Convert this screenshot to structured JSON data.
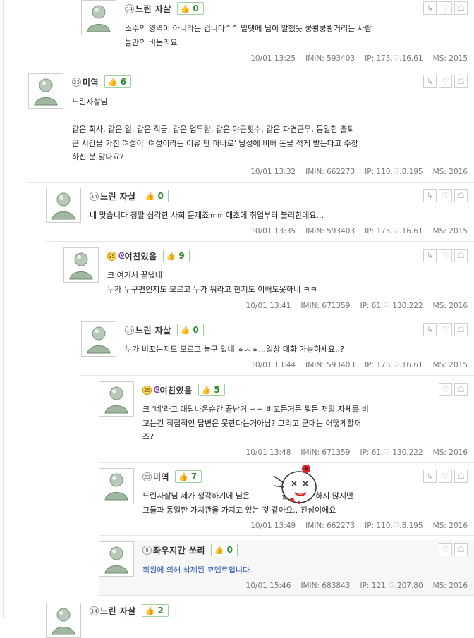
{
  "comments": [
    {
      "level": "14",
      "level_style": "gray",
      "nickname": "느린 자살",
      "likes": "0",
      "body": "소수의 영역이 아니라는 겁니다^^ 밑댓에 님이 말했듯 쿵쾅쿵쾅거리는 사람\n들만의 비논리요",
      "date": "10/01 13:25",
      "imin": "IMIN: 593403",
      "ip": "IP: 175.♡.16.61",
      "ms": "MS: 2015"
    },
    {
      "level": "23",
      "level_style": "gray",
      "nickname": "미역",
      "likes": "6",
      "body": "느린자살님\n\n같은 회사, 같은 일, 같은 직급, 같은 업무량, 같은 야근횟수, 같은 파견근무, 동일한 출퇴\n근 시간을 가진 여성이 '여성이라는 이유 단 하나로' 남성에 비해 돈을 적게 받는다고 주장\n하신 분 맞나요?",
      "date": "10/01 13:32",
      "imin": "IMIN: 662273",
      "ip": "IP: 110.♡.8.195",
      "ms": "MS: 2016"
    },
    {
      "level": "14",
      "level_style": "gray",
      "nickname": "느린 자살",
      "likes": "0",
      "body": "네 맞습니다 정말 심각한 사회 문제죠ㅠㅠ 애초에 취업부터 불리한데요...",
      "date": "10/01 13:35",
      "imin": "IMIN: 593403",
      "ip": "IP: 175.♡.16.61",
      "ms": "MS: 2015"
    },
    {
      "level": "35",
      "level_style": "gold",
      "nickname": "여친있음",
      "likes": "9",
      "body": "크 여기서 끝냈네\n누가 누구편인지도 모르고 누가 뭐라고 한지도 이해도못하네 ㅋㅋ",
      "date": "10/01 13:41",
      "imin": "IMIN: 671359",
      "ip": "IP: 61.♡.130.222",
      "ms": "MS: 2016"
    },
    {
      "level": "14",
      "level_style": "gray",
      "nickname": "느린 자살",
      "likes": "0",
      "body": "누가 비꼬는지도 모르고 놀구 있네 ㅎㅅㅎ...일상 대화 가능하세요..?",
      "date": "10/01 13:44",
      "imin": "IMIN: 593403",
      "ip": "IP: 175.♡.16.61",
      "ms": "MS: 2015"
    },
    {
      "level": "35",
      "level_style": "gold",
      "nickname": "여친있음",
      "likes": "5",
      "body": "크 '네'라고 대답나온순간 끝난거 ㅋㅋ 비꼬든거든 뭐든 저말 자체를 비\n꼬는건 직접적인 답변은 못한다는거아님? 그리고 군대는 어떻게할꺼\n죠?",
      "date": "10/01 13:48",
      "imin": "IMIN: 671359",
      "ip": "IP: 61.♡.130.222",
      "ms": "MS: 2016"
    },
    {
      "level": "23",
      "level_style": "gray",
      "nickname": "미역",
      "likes": "7",
      "body": "느린자살님 제가 생각하기에 님은             을 하거나 하지 않지만\n그들과 동일한 가치관을 가지고 있는 것 같아요.. 진심이에요",
      "date": "10/01 13:49",
      "imin": "IMIN: 662273",
      "ip": "IP: 110.♡.8.195",
      "ms": "MS: 2016"
    },
    {
      "level": "8",
      "level_style": "gray",
      "nickname": "좌우지간 쏘리",
      "likes": "0",
      "body": "회원에 의해 삭제된 코멘트입니다.",
      "date": "10/01 15:46",
      "imin": "IMIN: 683843",
      "ip": "IP: 121.♡.207.80",
      "ms": "MS: 2016"
    },
    {
      "level": "14",
      "level_style": "gray",
      "nickname": "느린 자살",
      "likes": "2",
      "body": "",
      "date": "",
      "imin": "",
      "ip": "",
      "ms": ""
    }
  ],
  "icons": {
    "reply": "reply-arrow-icon",
    "like": "heart-icon",
    "report": "siren-icon",
    "thumb": "thumbs-up-icon"
  },
  "colors": {
    "like_border": "#9fd09f",
    "like_text": "#2c8a2c",
    "deleted_text": "#2a55b3",
    "gold_level": "#ffd85a"
  }
}
